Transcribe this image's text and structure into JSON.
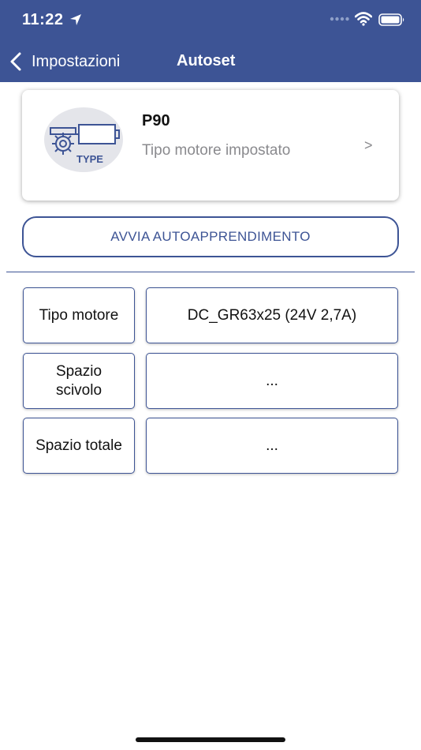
{
  "status_bar": {
    "time": "11:22",
    "icons": [
      "location-arrow-icon",
      "cellular-signal-icon",
      "wifi-icon",
      "battery-icon"
    ]
  },
  "nav": {
    "back_label": "Impostazioni",
    "title": "Autoset"
  },
  "motor_card": {
    "name": "P90",
    "subtitle": "Tipo motore impostato",
    "chevron": ">",
    "icon_text": "TYPE",
    "icon": "motor-type-icon"
  },
  "autolearn_button": {
    "label": "AVVIA AUTOAPPRENDIMENTO"
  },
  "info_rows": [
    {
      "label": "Tipo motore",
      "value": "DC_GR63x25 (24V 2,7A)"
    },
    {
      "label": "Spazio scivolo",
      "value": "..."
    },
    {
      "label": "Spazio totale",
      "value": "..."
    }
  ],
  "colors": {
    "header_bg": "#3d5495",
    "accent": "#3d5495",
    "secondary_text": "#8a8a8e"
  }
}
